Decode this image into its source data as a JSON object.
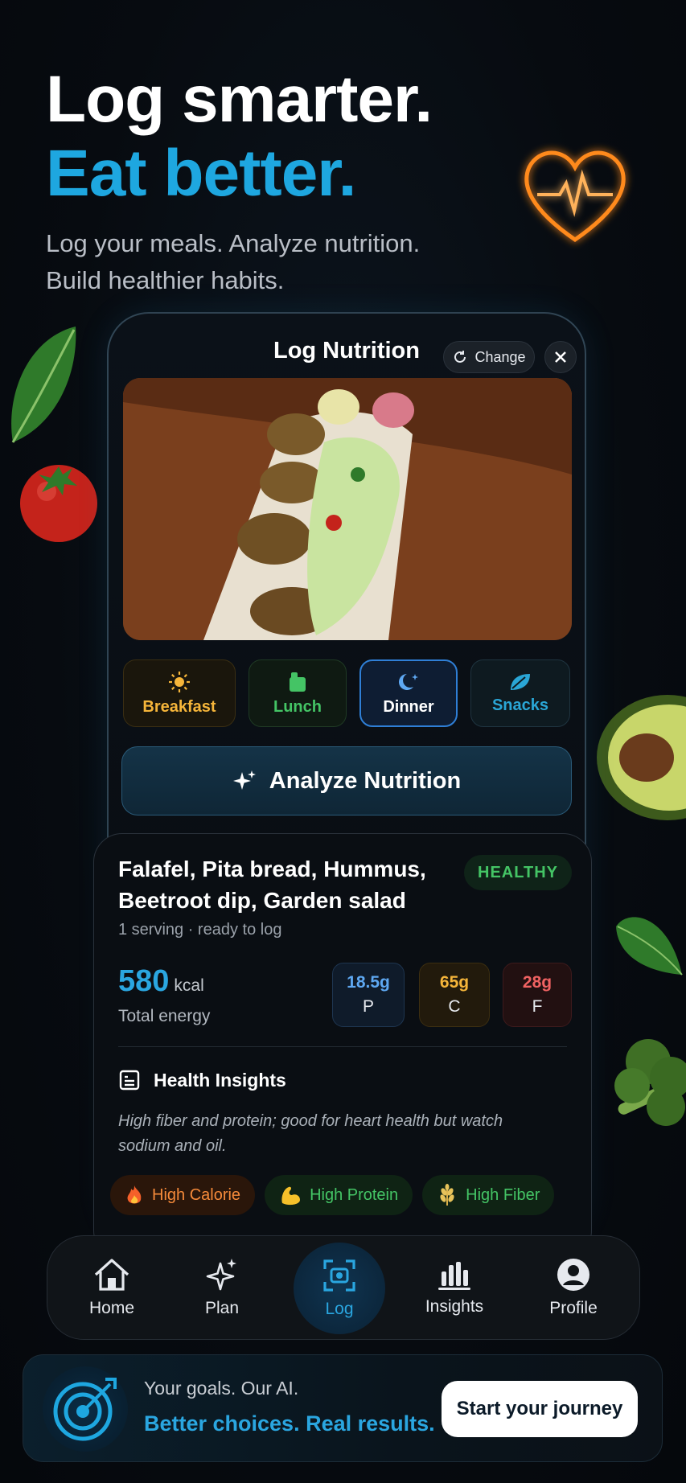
{
  "hero": {
    "line1": "Log smarter.",
    "line2": "Eat better.",
    "subtitle_line1": "Log your meals. Analyze nutrition.",
    "subtitle_line2": "Build healthier habits."
  },
  "phone": {
    "title": "Log Nutrition",
    "change_label": "Change",
    "meals": [
      {
        "label": "Breakfast",
        "icon": "sun-icon"
      },
      {
        "label": "Lunch",
        "icon": "lunchbox-icon"
      },
      {
        "label": "Dinner",
        "icon": "moon-icon",
        "selected": true
      },
      {
        "label": "Snacks",
        "icon": "leaf-icon"
      }
    ],
    "analyze_label": "Analyze Nutrition"
  },
  "result": {
    "dish_line1": "Falafel, Pita bread, Hummus,",
    "dish_line2": "Beetroot dip, Garden salad",
    "badge": "HEALTHY",
    "serving": "1 serving · ready to log",
    "kcal": "580",
    "kcal_unit": "kcal",
    "energy_label": "Total energy",
    "macros": {
      "protein": {
        "value": "18.5g",
        "key": "P"
      },
      "carbs": {
        "value": "65g",
        "key": "C"
      },
      "fat": {
        "value": "28g",
        "key": "F"
      }
    },
    "insights_title": "Health Insights",
    "insights_text": "High fiber and protein; good for heart health but watch sodium and oil.",
    "chips": [
      "High Calorie",
      "High Protein",
      "High Fiber"
    ]
  },
  "nav": {
    "items": [
      {
        "label": "Home",
        "icon": "home-icon"
      },
      {
        "label": "Plan",
        "icon": "sparkles-icon"
      },
      {
        "label": "Log",
        "icon": "scan-icon",
        "active": true
      },
      {
        "label": "Insights",
        "icon": "bar-chart-icon"
      },
      {
        "label": "Profile",
        "icon": "user-icon"
      }
    ]
  },
  "banner": {
    "line1": "Your goals. Our AI.",
    "line2": "Better choices. Real results.",
    "cta": "Start your journey"
  },
  "colors": {
    "accent": "#1ea7e0",
    "healthy": "#44c465",
    "breakfast": "#f5b53a",
    "fat": "#f06262"
  }
}
